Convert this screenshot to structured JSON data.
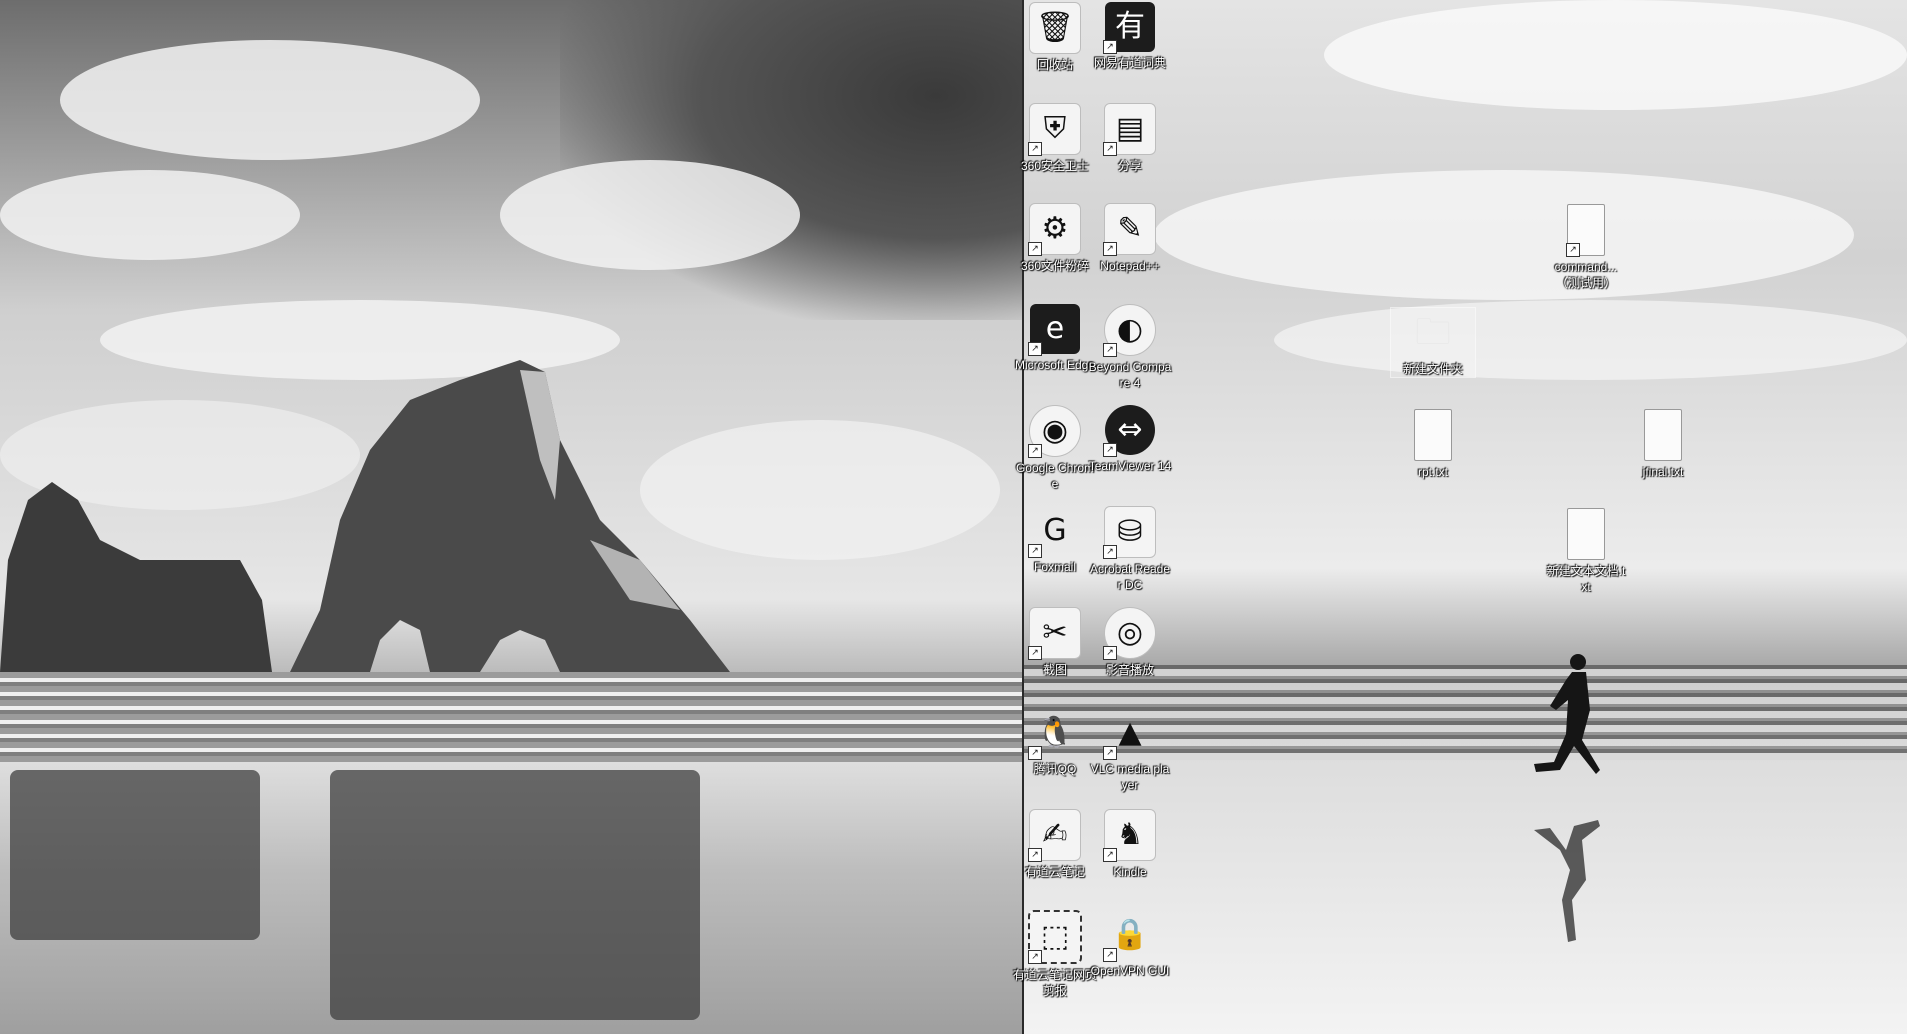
{
  "desktop": {
    "left_monitor": {
      "scene": "sea-stacks-beach"
    },
    "right_monitor": {
      "scene": "runner-on-beach"
    },
    "icons": [
      {
        "id": "recycle-bin",
        "label": "回收站",
        "icon": "recycle-bin-icon"
      },
      {
        "id": "netease-youdao",
        "label": "网易有道词典",
        "icon": "youdao-dictionary-icon"
      },
      {
        "id": "360-security",
        "label": "360安全卫士",
        "icon": "shield-icon"
      },
      {
        "id": "winrar",
        "label": "分享",
        "icon": "archive-icon"
      },
      {
        "id": "360-browser-tools",
        "label": "360文件粉碎",
        "icon": "file-shredder-icon"
      },
      {
        "id": "notepad-plus",
        "label": "Notepad++",
        "icon": "notepad-icon"
      },
      {
        "id": "ms-edge",
        "label": "Microsoft Edge",
        "icon": "edge-browser-icon"
      },
      {
        "id": "beyond-compare",
        "label": "Beyond Compare 4",
        "icon": "compare-disc-icon"
      },
      {
        "id": "google-chrome",
        "label": "Google Chrome",
        "icon": "chrome-browser-icon"
      },
      {
        "id": "teamviewer",
        "label": "TeamViewer 14",
        "icon": "teamviewer-icon"
      },
      {
        "id": "foxmail",
        "label": "Foxmail",
        "icon": "mail-icon"
      },
      {
        "id": "acrobat",
        "label": "Acrobat Reader DC",
        "icon": "pdf-reader-icon"
      },
      {
        "id": "screenshot-tool",
        "label": "截图",
        "icon": "screenshot-icon"
      },
      {
        "id": "dvd-player",
        "label": "影音播放",
        "icon": "media-disc-icon"
      },
      {
        "id": "tencent-qq",
        "label": "腾讯QQ",
        "icon": "qq-penguin-icon"
      },
      {
        "id": "vlc",
        "label": "VLC media player",
        "icon": "vlc-cone-icon"
      },
      {
        "id": "youdao-note",
        "label": "有道云笔记",
        "icon": "note-pen-icon"
      },
      {
        "id": "kindle",
        "label": "Kindle",
        "icon": "kindle-reader-icon"
      },
      {
        "id": "youdao-screenshot",
        "label": "有道云笔记网页剪报",
        "icon": "clip-frame-icon"
      },
      {
        "id": "openvpn",
        "label": "OpenVPN GUI",
        "icon": "vpn-lock-icon"
      },
      {
        "id": "commands-txt",
        "label": "command...（测试用）",
        "icon": "text-file-icon"
      },
      {
        "id": "new-folder",
        "label": "新建文件夹",
        "icon": "folder-icon"
      },
      {
        "id": "rpt-txt",
        "label": "rpt.txt",
        "icon": "text-file-icon"
      },
      {
        "id": "jfinal-file",
        "label": "jfinal.txt",
        "icon": "text-file-icon"
      },
      {
        "id": "new-text-doc",
        "label": "新建文本文档.txt",
        "icon": "text-file-icon"
      }
    ]
  }
}
